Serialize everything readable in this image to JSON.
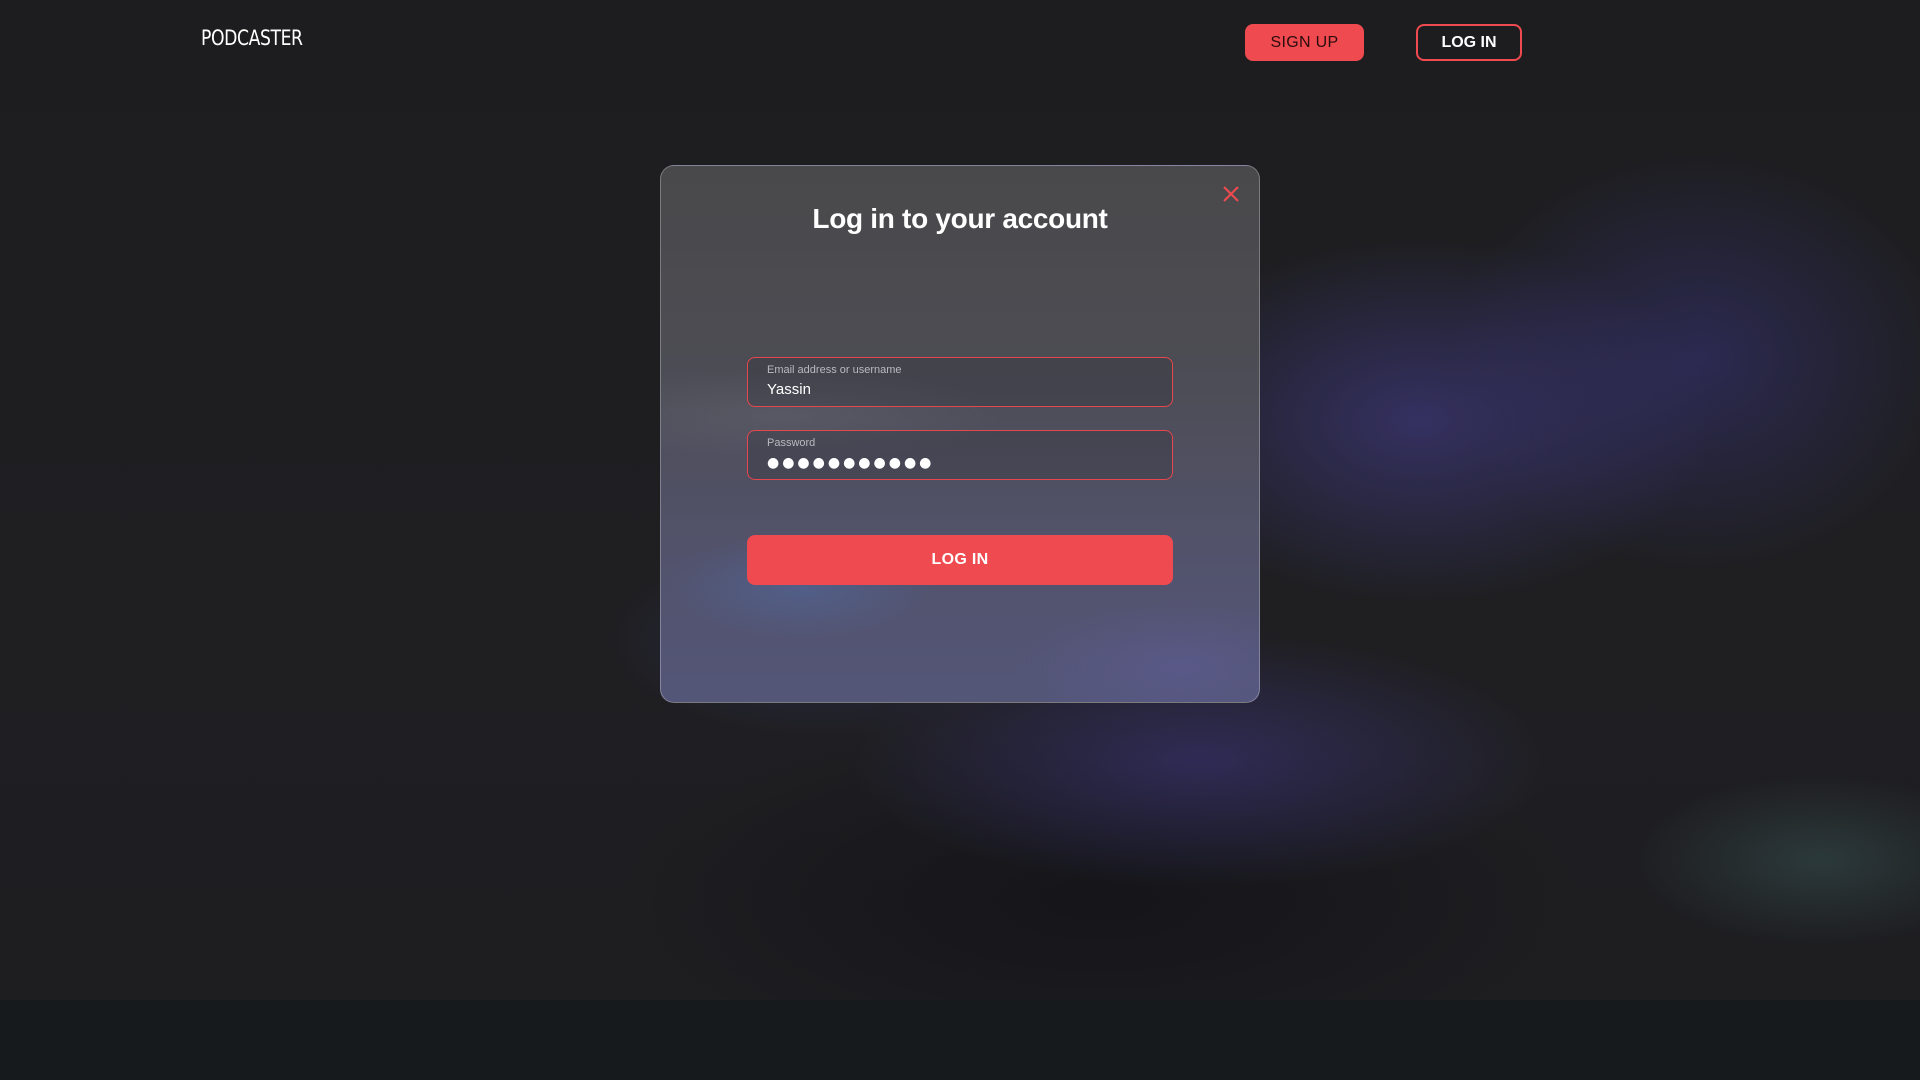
{
  "header": {
    "brand": "PODCASTER",
    "signup_label": "SIGN UP",
    "login_label": "LOG IN"
  },
  "modal": {
    "title": "Log in to your account",
    "close_icon": "close-icon",
    "email": {
      "label": "Email address or username",
      "value": "Yassin"
    },
    "password": {
      "label": "Password",
      "masked_value": "●●●●●●●●●●●"
    },
    "submit_label": "LOG IN"
  },
  "colors": {
    "accent": "#ef4a4f",
    "background": "#1f1f21",
    "footer": "#161a1c"
  }
}
